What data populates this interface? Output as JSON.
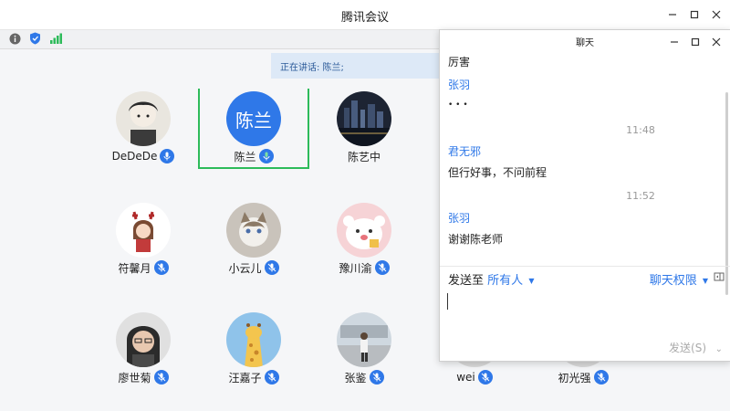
{
  "app": {
    "title": "腾讯会议"
  },
  "status": {
    "speaking_label": "正在讲话: 陈兰;"
  },
  "participants": [
    {
      "name": "DeDeDe"
    },
    {
      "name": "陈兰",
      "avatar_text": "陈兰"
    },
    {
      "name": "陈艺中"
    },
    {
      "name": "符馨月"
    },
    {
      "name": "小云儿"
    },
    {
      "name": "豫川渝"
    },
    {
      "name": "廖世菊"
    },
    {
      "name": "汪嘉子"
    },
    {
      "name": "张鉴"
    },
    {
      "name": "wei"
    },
    {
      "name": "初光强"
    }
  ],
  "chat": {
    "title": "聊天",
    "messages": [
      {
        "text": "厉害"
      },
      {
        "name": "张羽"
      },
      {
        "text": "• • •"
      },
      {
        "time": "11:48"
      },
      {
        "name": "君无邪"
      },
      {
        "text": "但行好事，不问前程"
      },
      {
        "time": "11:52"
      },
      {
        "name": "张羽"
      },
      {
        "text": "谢谢陈老师"
      }
    ],
    "send_to_label": "发送至",
    "send_to_target": "所有人",
    "permission_label": "聊天权限",
    "send_button": "发送(S)"
  },
  "colors": {
    "accent": "#2f78e8",
    "active_border": "#2dbb5a",
    "speaking_bg": "#dde9f7"
  }
}
